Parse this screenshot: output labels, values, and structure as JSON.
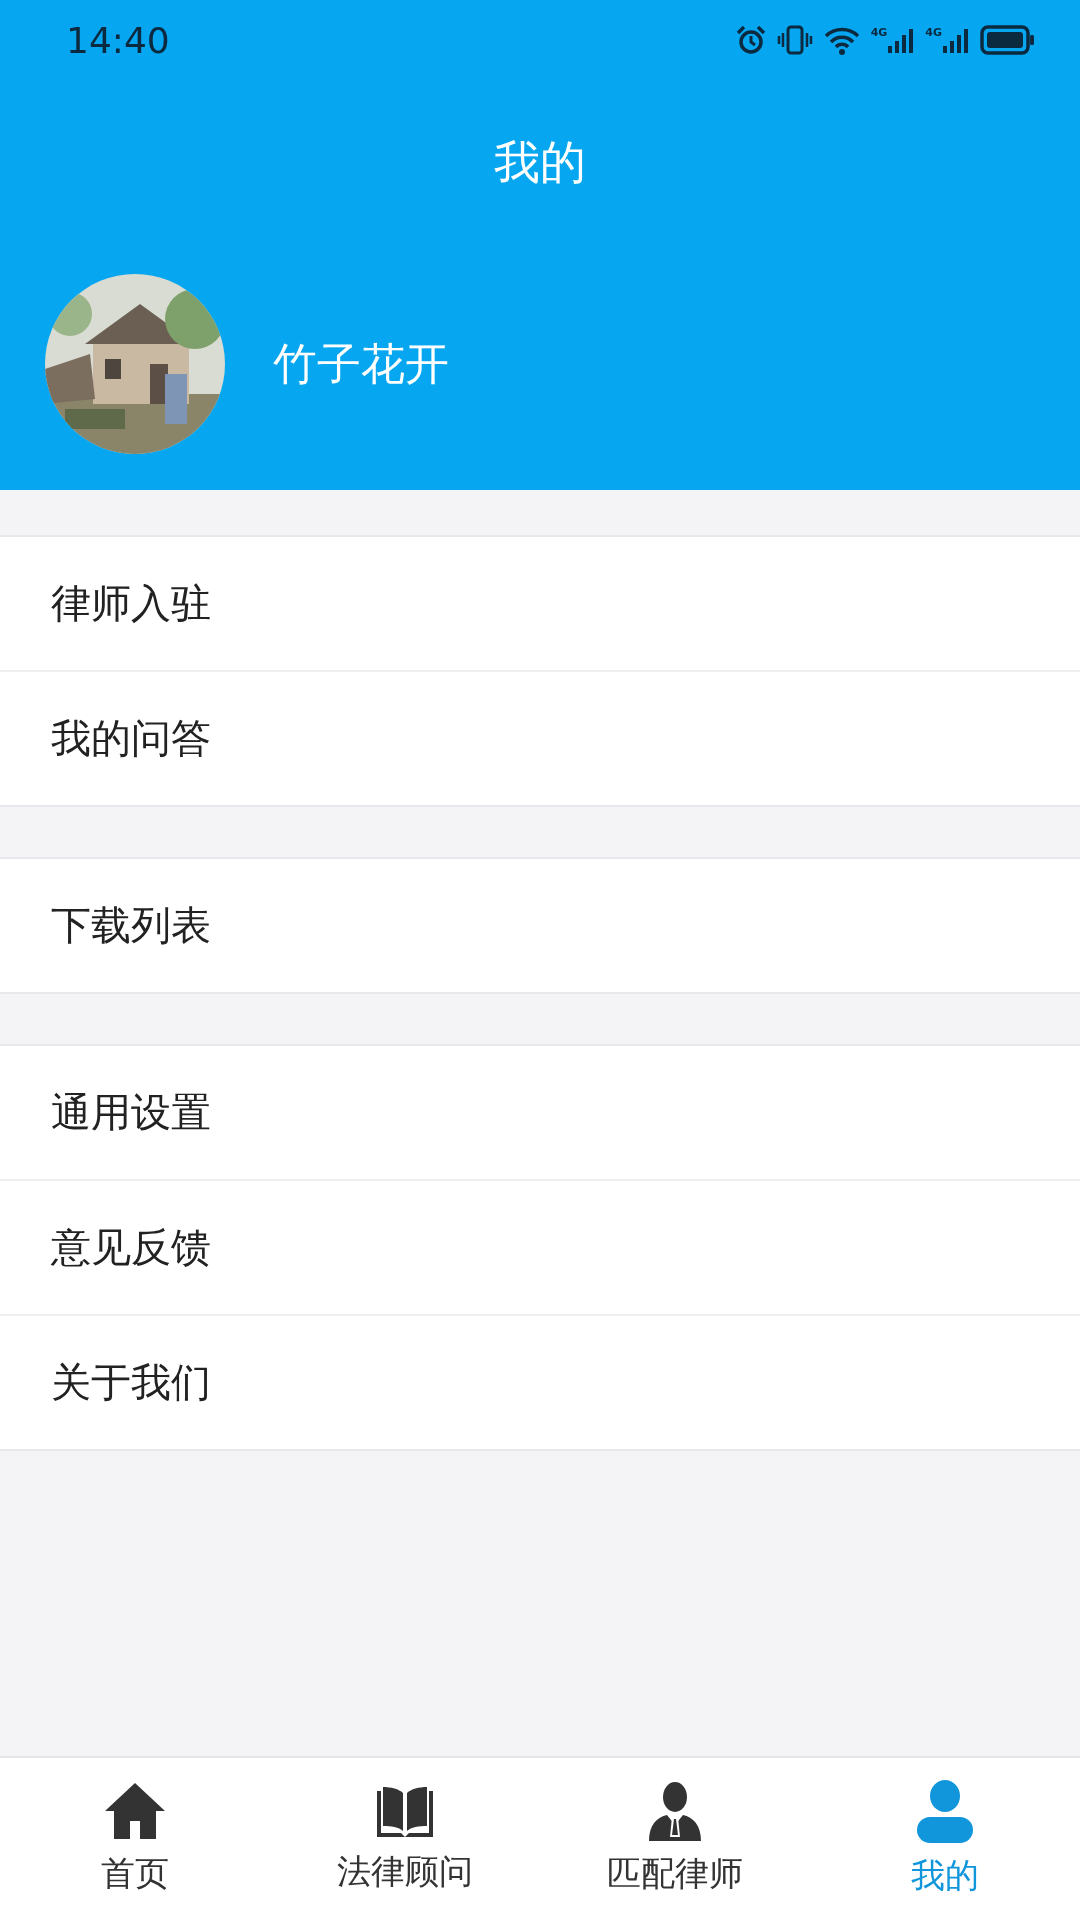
{
  "status_bar": {
    "time": "14:40",
    "networks": [
      "4G",
      "4G"
    ]
  },
  "header": {
    "title": "我的"
  },
  "profile": {
    "name": "竹子花开"
  },
  "menu_groups": [
    {
      "items": [
        {
          "label": "律师入驻"
        },
        {
          "label": "我的问答"
        }
      ]
    },
    {
      "items": [
        {
          "label": "下载列表"
        }
      ]
    },
    {
      "items": [
        {
          "label": "通用设置"
        },
        {
          "label": "意见反馈"
        },
        {
          "label": "关于我们"
        }
      ]
    }
  ],
  "tab_bar": [
    {
      "label": "首页",
      "selected": false
    },
    {
      "label": "法律顾问",
      "selected": false
    },
    {
      "label": "匹配律师",
      "selected": false
    },
    {
      "label": "我的",
      "selected": true
    }
  ]
}
